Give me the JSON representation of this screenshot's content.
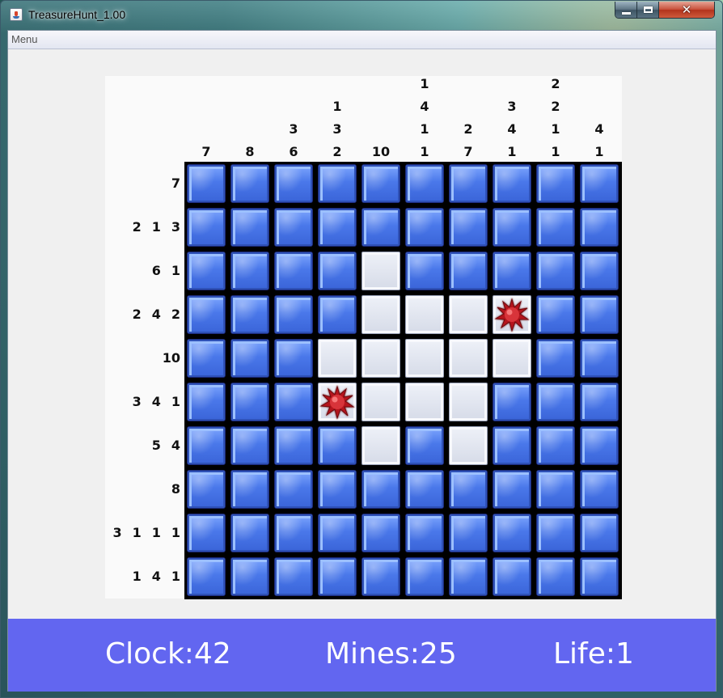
{
  "window": {
    "title": "TreasureHunt_1.00"
  },
  "menu": {
    "label": "Menu"
  },
  "board": {
    "rows": 10,
    "cols": 10,
    "column_clues": [
      [
        "7"
      ],
      [
        "8"
      ],
      [
        "3",
        "6"
      ],
      [
        "1",
        "3",
        "2"
      ],
      [
        "10"
      ],
      [
        "1",
        "4",
        "1",
        "1"
      ],
      [
        "2",
        "7"
      ],
      [
        "3",
        "4",
        "1"
      ],
      [
        "2",
        "2",
        "1",
        "1"
      ],
      [
        "4",
        "1"
      ]
    ],
    "row_clues": [
      [
        "7"
      ],
      [
        "2",
        "1",
        "3"
      ],
      [
        "6",
        "1"
      ],
      [
        "2",
        "4",
        "2"
      ],
      [
        "10"
      ],
      [
        "3",
        "4",
        "1"
      ],
      [
        "5",
        "4"
      ],
      [
        "8"
      ],
      [
        "3",
        "1",
        "1",
        "1"
      ],
      [
        "1",
        "4",
        "1"
      ]
    ],
    "revealed_cells": [
      [
        2,
        4
      ],
      [
        3,
        4
      ],
      [
        3,
        5
      ],
      [
        3,
        6
      ],
      [
        3,
        7
      ],
      [
        4,
        3
      ],
      [
        4,
        4
      ],
      [
        4,
        5
      ],
      [
        4,
        6
      ],
      [
        4,
        7
      ],
      [
        5,
        3
      ],
      [
        5,
        4
      ],
      [
        5,
        5
      ],
      [
        5,
        6
      ],
      [
        6,
        4
      ],
      [
        6,
        6
      ]
    ],
    "mine_cells": [
      [
        3,
        7
      ],
      [
        5,
        3
      ]
    ],
    "hidden_cell_color": "#4a78ea",
    "revealed_cell_color": "#d6dbe8",
    "mine_color": "#c8232c",
    "mine_icon": "spiky-mine-icon"
  },
  "status": {
    "clock_label": "Clock:42",
    "mines_label": "Mines:25",
    "life_label": "Life:1",
    "bar_color": "#6266f0"
  }
}
